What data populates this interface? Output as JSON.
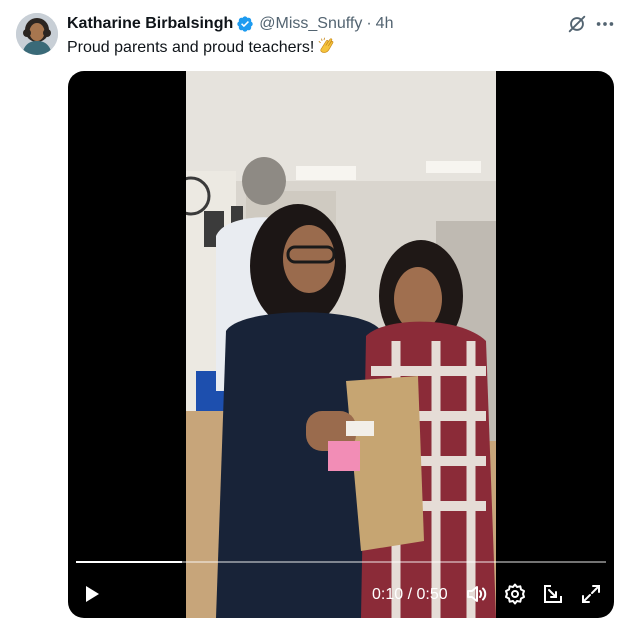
{
  "tweet": {
    "author_name": "Katharine Birbalsingh",
    "handle": "@Miss_Snuffy",
    "separator": "·",
    "time": "4h",
    "text": "Proud parents and proud teachers!",
    "emoji": "clapping-hands"
  },
  "icons": {
    "verified": "verified-badge-icon",
    "grok": "grok-icon",
    "more": "more-icon",
    "play": "play-icon",
    "volume": "volume-icon",
    "settings": "settings-icon",
    "pip": "picture-in-picture-icon",
    "fullscreen": "fullscreen-icon"
  },
  "video": {
    "current_time": "0:10",
    "duration": "0:50",
    "timecode": "0:10 / 0:50",
    "progress": 0.2
  },
  "colors": {
    "verified": "#1d9bf0",
    "muted_text": "#536471",
    "video_bg": "#000000"
  }
}
